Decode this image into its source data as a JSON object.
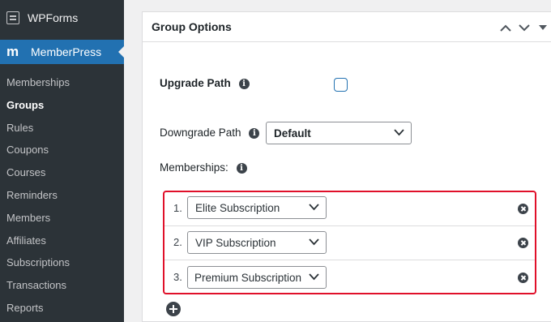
{
  "sidebar": {
    "wpforms_label": "WPForms",
    "memberpress_label": "MemberPress",
    "memberpress_logo": "m",
    "items": [
      {
        "label": "Memberships"
      },
      {
        "label": "Groups"
      },
      {
        "label": "Rules"
      },
      {
        "label": "Coupons"
      },
      {
        "label": "Courses"
      },
      {
        "label": "Reminders"
      },
      {
        "label": "Members"
      },
      {
        "label": "Affiliates"
      },
      {
        "label": "Subscriptions"
      },
      {
        "label": "Transactions"
      },
      {
        "label": "Reports"
      }
    ],
    "active_item": "Groups"
  },
  "panel": {
    "title": "Group Options",
    "upgrade_path_label": "Upgrade Path",
    "upgrade_path_checked": false,
    "downgrade_path_label": "Downgrade Path",
    "downgrade_path_value": "Default",
    "memberships_label": "Memberships:",
    "memberships": [
      {
        "num": "1.",
        "value": "Elite Subscription"
      },
      {
        "num": "2.",
        "value": "VIP Subscription"
      },
      {
        "num": "3.",
        "value": "Premium Subscription"
      }
    ]
  },
  "colors": {
    "sidebar_bg": "#2c3338",
    "accent": "#2271b1",
    "highlight_border": "#e0102a"
  },
  "icons": {
    "info": "info-icon",
    "remove": "remove-icon",
    "add": "add-icon"
  }
}
